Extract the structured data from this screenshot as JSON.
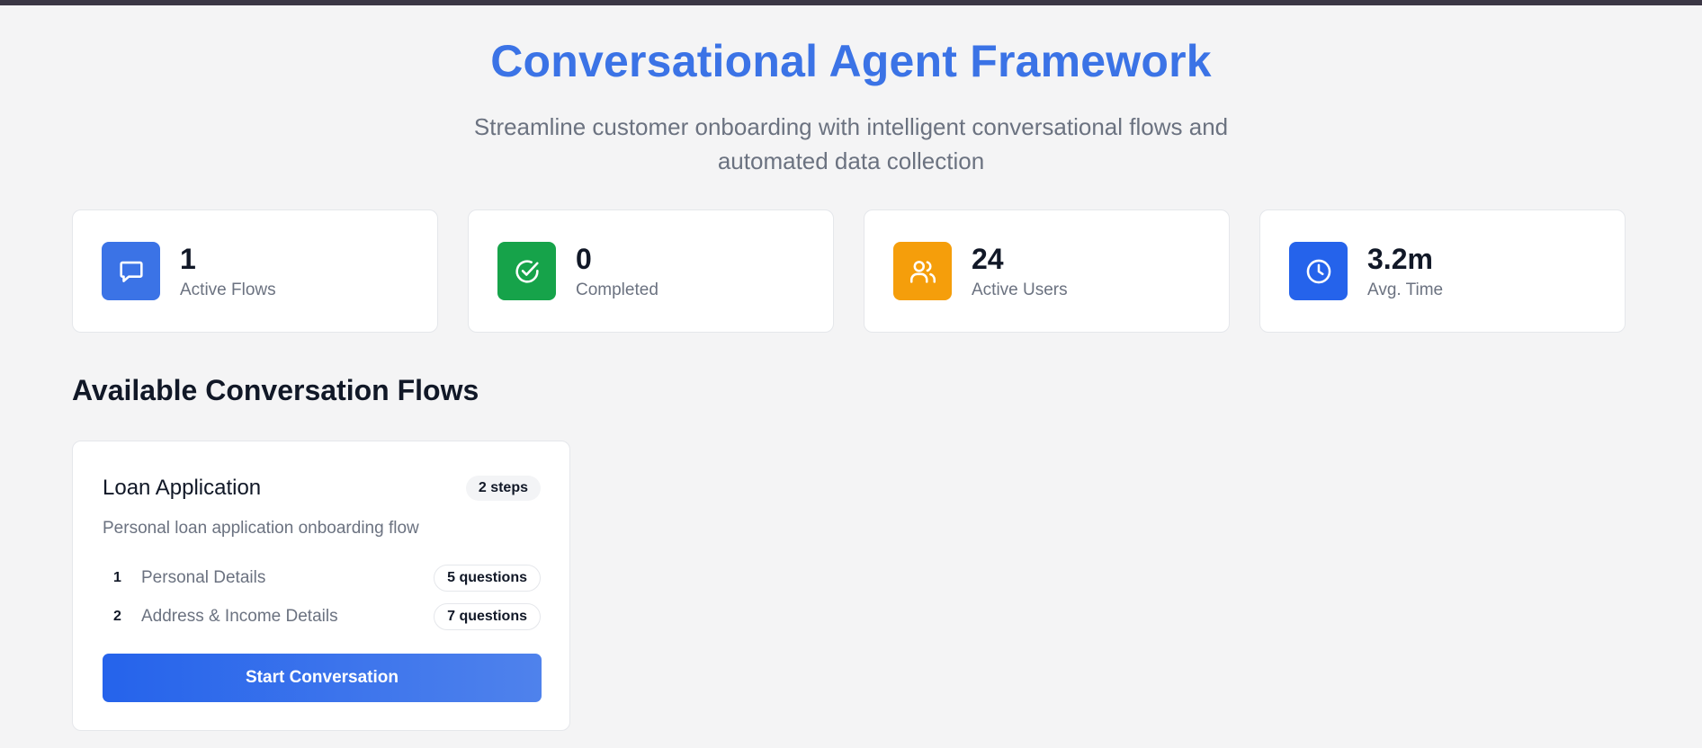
{
  "header": {
    "title": "Conversational Agent Framework",
    "subtitle": "Streamline customer onboarding with intelligent conversational flows and automated data collection"
  },
  "stats": [
    {
      "value": "1",
      "label": "Active Flows",
      "icon": "chat-icon",
      "color": "#3b73e6"
    },
    {
      "value": "0",
      "label": "Completed",
      "icon": "check-circle-icon",
      "color": "#16a34a"
    },
    {
      "value": "24",
      "label": "Active Users",
      "icon": "users-icon",
      "color": "#f59e0b"
    },
    {
      "value": "3.2m",
      "label": "Avg. Time",
      "icon": "clock-icon",
      "color": "#2563eb"
    }
  ],
  "flows_section": {
    "title": "Available Conversation Flows"
  },
  "flows": [
    {
      "title": "Loan Application",
      "steps_badge": "2 steps",
      "description": "Personal loan application onboarding flow",
      "steps": [
        {
          "number": "1",
          "name": "Personal Details",
          "questions": "5 questions"
        },
        {
          "number": "2",
          "name": "Address & Income Details",
          "questions": "7 questions"
        }
      ],
      "button_label": "Start Conversation"
    }
  ],
  "colors": {
    "accent": "#3b73e6",
    "background": "#f4f4f5"
  }
}
